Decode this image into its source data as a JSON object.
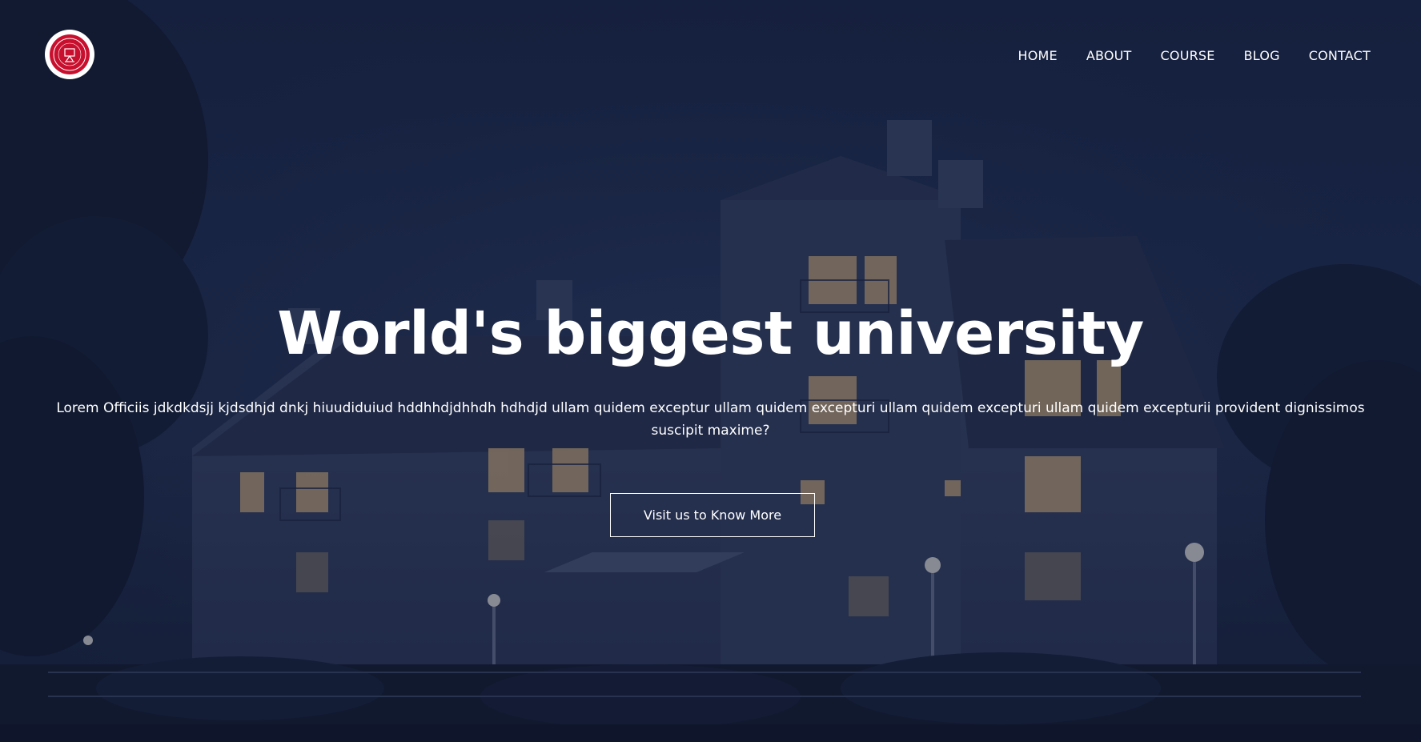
{
  "header": {
    "logo_icon": "university-seal-icon",
    "nav": [
      {
        "label": "HOME"
      },
      {
        "label": "ABOUT"
      },
      {
        "label": "COURSE"
      },
      {
        "label": "BLOG"
      },
      {
        "label": "CONTACT"
      }
    ]
  },
  "hero": {
    "title": "World's biggest university",
    "description": "Lorem Officiis jdkdkdsjj kjdsdhjd dnkj hiuudiduiud hddhhdjdhhdh hdhdjd ullam quidem exceptur ullam quidem excepturi ullam quidem excepturi ullam quidem excepturii provident dignissimos suscipit maxime?",
    "cta_label": "Visit us to Know More"
  },
  "colors": {
    "overlay": "#1e2a4a",
    "logo_red": "#c8102e",
    "text": "#ffffff"
  }
}
